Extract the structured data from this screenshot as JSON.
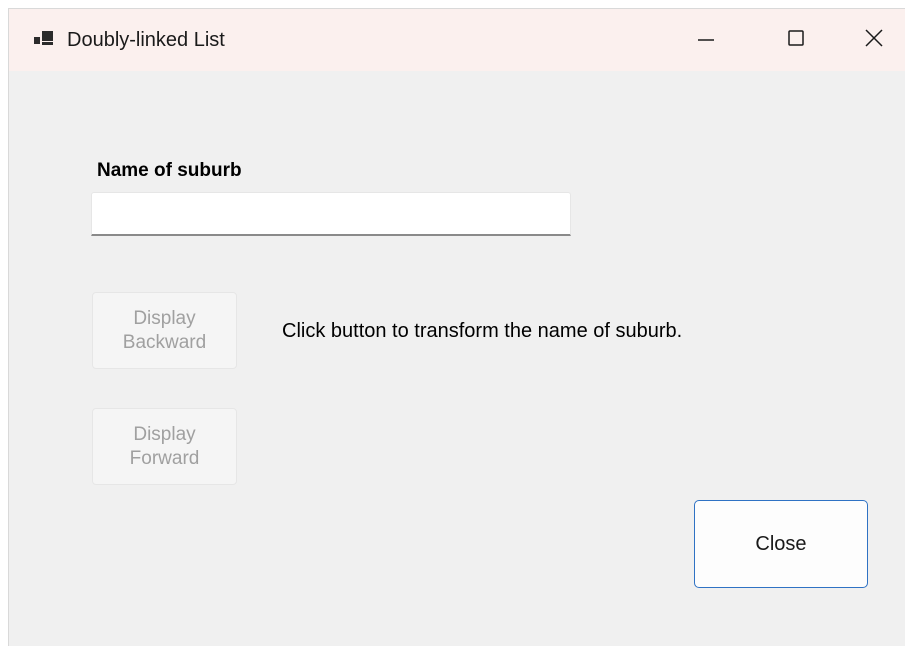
{
  "window": {
    "title": "Doubly-linked List",
    "icon": "app-icon",
    "controls": {
      "minimize": "minimize-icon",
      "maximize": "maximize-icon",
      "close": "close-icon"
    }
  },
  "form": {
    "suburb_label": "Name of suburb",
    "suburb_input": {
      "value": "",
      "placeholder": ""
    },
    "display_backward_label": "Display Backward",
    "display_backward_lines": [
      "Display",
      "Backward"
    ],
    "display_forward_label": "Display Forward",
    "display_forward_lines": [
      "Display",
      "Forward"
    ],
    "hint_text": "Click button to transform the name of suburb.",
    "close_label": "Close"
  },
  "colors": {
    "titlebar": "#fbf0ee",
    "client_area": "#f0f0f0",
    "accent_border": "#2f72c4",
    "disabled_text": "#a0a0a0"
  }
}
